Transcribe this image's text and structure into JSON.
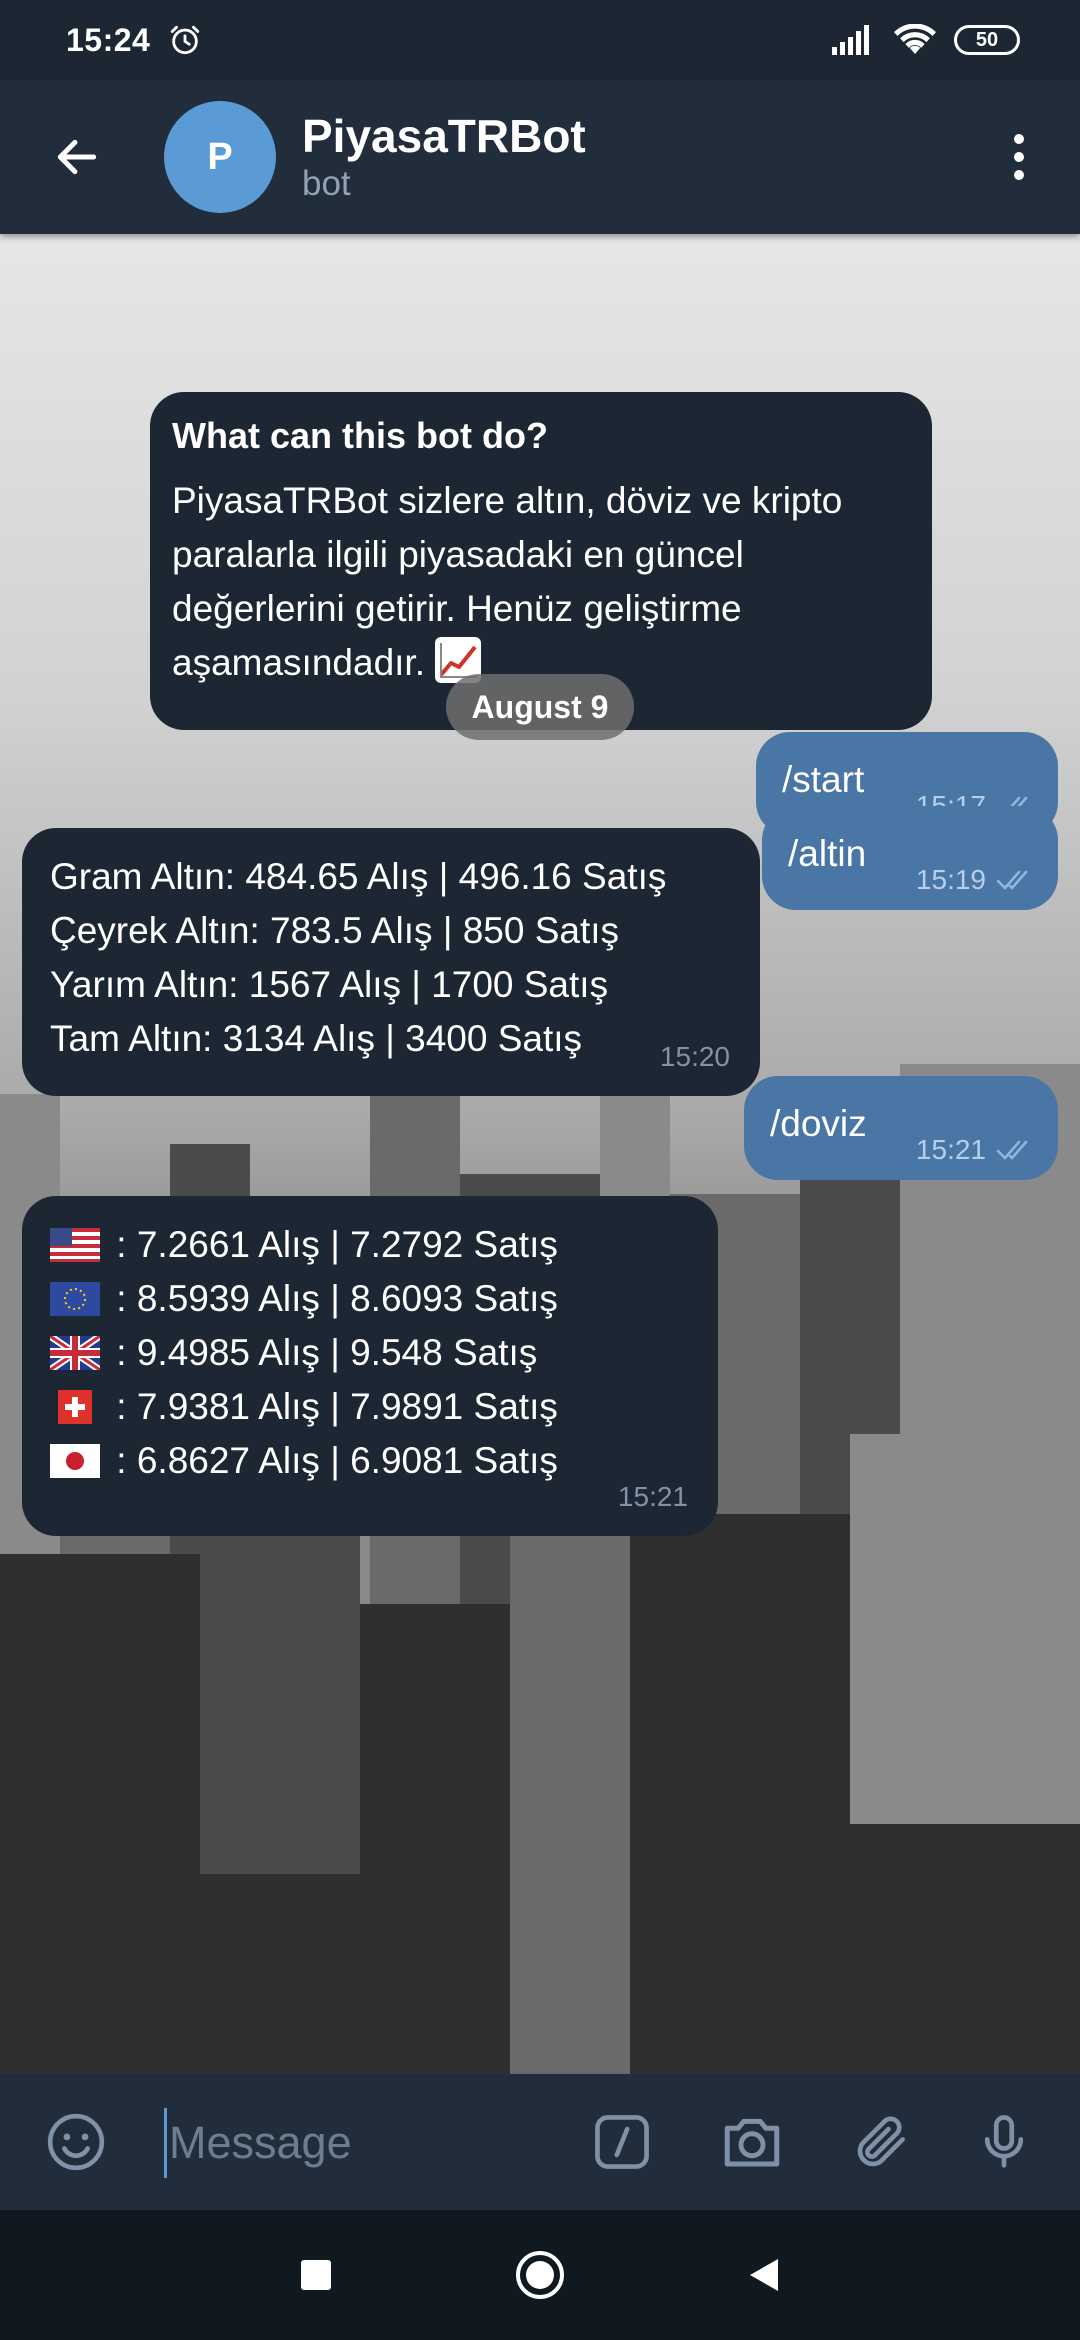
{
  "status_bar": {
    "time": "15:24",
    "battery": "50"
  },
  "header": {
    "avatar_letter": "P",
    "title": "PiyasaTRBot",
    "subtitle": "bot"
  },
  "intro": {
    "title": "What can this bot do?",
    "body": "PiyasaTRBot sizlere altın, döviz ve kripto paralarla ilgili piyasadaki en güncel değerlerini getirir. Henüz geliştirme aşamasındadır."
  },
  "date_separator": "August 9",
  "messages": [
    {
      "type": "outgoing",
      "text": "/start",
      "time": "15:17"
    },
    {
      "type": "outgoing",
      "text": "/altin",
      "time": "15:19"
    },
    {
      "type": "incoming",
      "lines": [
        "Gram Altın: 484.65 Alış | 496.16 Satış",
        "Çeyrek Altın: 783.5 Alış | 850 Satış",
        "Yarım Altın: 1567 Alış | 1700 Satış",
        "Tam Altın: 3134 Alış | 3400 Satış"
      ],
      "time": "15:20"
    },
    {
      "type": "outgoing",
      "text": "/doviz",
      "time": "15:21"
    },
    {
      "type": "incoming",
      "lines": [
        " : 7.2661 Alış | 7.2792 Satış",
        " : 8.5939 Alış | 8.6093 Satış",
        " : 9.4985 Alış | 9.548 Satış",
        " : 7.9381 Alış | 7.9891 Satış",
        " : 6.8627 Alış | 6.9081 Satış"
      ],
      "flags": [
        "us-flag-icon",
        "eu-flag-icon",
        "uk-flag-icon",
        "ch-flag-icon",
        "jp-flag-icon"
      ],
      "time": "15:21"
    }
  ],
  "composer": {
    "placeholder": "Message"
  },
  "colors": {
    "header_bg": "#212d3b",
    "incoming_bubble": "#1d2733",
    "outgoing_bubble": "#4a76a6",
    "avatar": "#5b9bd5"
  }
}
